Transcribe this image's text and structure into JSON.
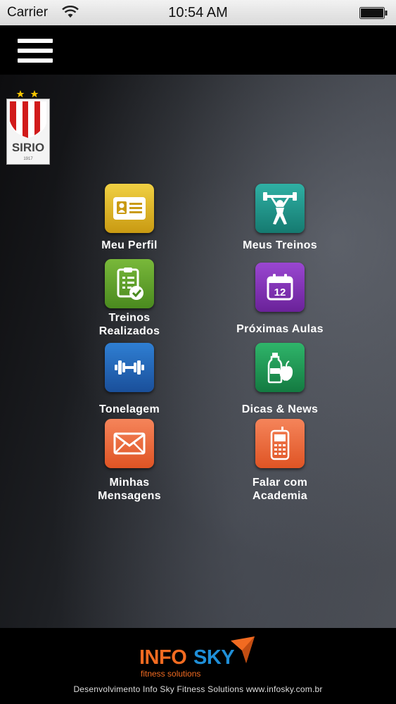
{
  "status_bar": {
    "carrier": "Carrier",
    "time": "10:54 AM"
  },
  "club_logo": {
    "name": "SIRIO",
    "year": "1917"
  },
  "menu": [
    {
      "id": "meu-perfil",
      "label": "Meu Perfil",
      "icon": "profile-card-icon",
      "color": "#d6b21e"
    },
    {
      "id": "meus-treinos",
      "label": "Meus Treinos",
      "icon": "weightlifter-icon",
      "color": "#1f8f86"
    },
    {
      "id": "treinos-realizados",
      "label": "Treinos\nRealizados",
      "icon": "clipboard-check-icon",
      "color": "#5a9a2a"
    },
    {
      "id": "proximas-aulas",
      "label": "Próximas Aulas",
      "icon": "calendar-icon",
      "color": "#7b2fb0",
      "day": "12"
    },
    {
      "id": "tonelagem",
      "label": "Tonelagem",
      "icon": "dumbbell-icon",
      "color": "#1f63b5"
    },
    {
      "id": "dicas-news",
      "label": "Dicas & News",
      "icon": "bottle-apple-icon",
      "color": "#1f9a55"
    },
    {
      "id": "minhas-mensagens",
      "label": "Minhas\nMensagens",
      "icon": "envelope-icon",
      "color": "#ee6b3a"
    },
    {
      "id": "falar-academia",
      "label": "Falar com\nAcademia",
      "icon": "phone-icon",
      "color": "#ee6b3a"
    }
  ],
  "footer": {
    "brand_info": "INFO",
    "brand_sky": "SKY",
    "brand_sub": "fitness solutions",
    "credit": "Desenvolvimento Info Sky Fitness Solutions www.infosky.com.br"
  }
}
